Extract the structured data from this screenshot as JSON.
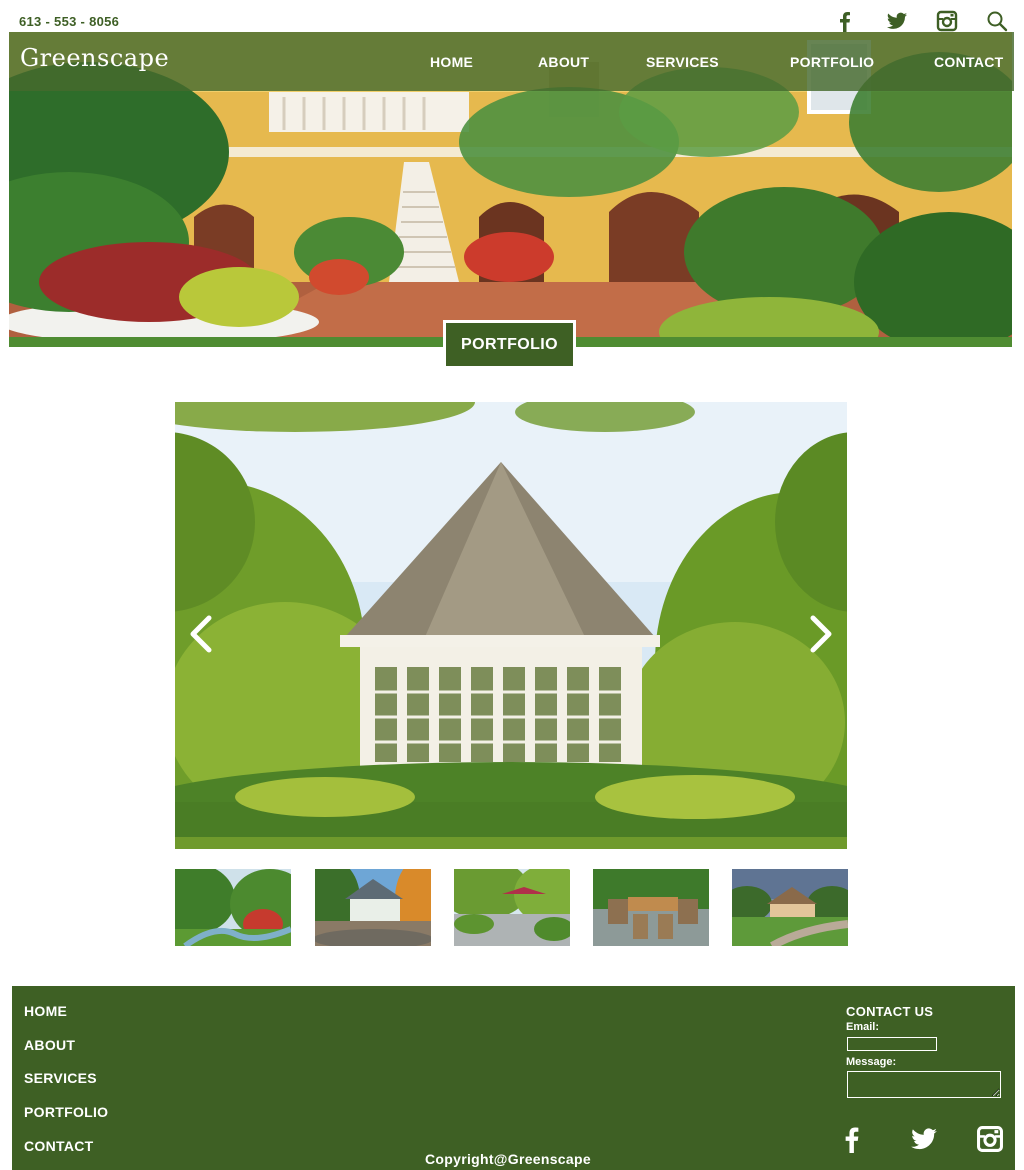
{
  "topbar": {
    "phone": "613 - 553 - 8056",
    "icons": [
      "facebook-icon",
      "twitter-icon",
      "instagram-icon",
      "search-icon"
    ]
  },
  "header": {
    "logo": "Greenscape",
    "nav": [
      "HOME",
      "ABOUT",
      "SERVICES",
      "PORTFOLIO",
      "CONTACT"
    ]
  },
  "hero": {
    "section_title": "PORTFOLIO"
  },
  "gallery": {
    "prev_icon": "chevron-left-icon",
    "next_icon": "chevron-right-icon",
    "thumbnail_count": 5
  },
  "footer": {
    "links": [
      "HOME",
      "ABOUT",
      "SERVICES",
      "PORTFOLIO",
      "CONTACT"
    ],
    "contact_title": "CONTACT US",
    "email_label": "Email:",
    "message_label": "Message:",
    "icons": [
      "facebook-icon",
      "twitter-icon",
      "instagram-icon"
    ],
    "copyright": "Copyright@Greenscape"
  },
  "colors": {
    "brand_green": "#3e6024",
    "nav_overlay": "#46692d",
    "text_green": "#3e5f25",
    "white": "#ffffff"
  }
}
